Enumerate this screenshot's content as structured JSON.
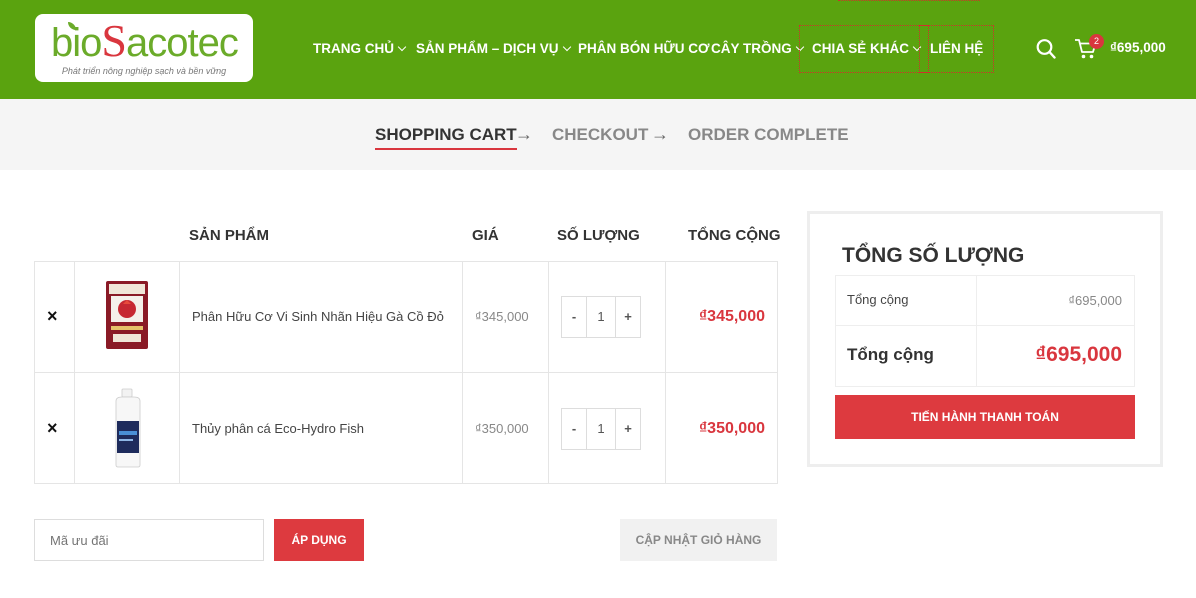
{
  "logo": {
    "text_a": "bio",
    "text_b": "S",
    "text_c": "acotec",
    "tagline": "Phát triển nông nghiệp sạch và bền vững"
  },
  "nav": [
    {
      "label": "TRANG CHỦ",
      "dropdown": true
    },
    {
      "label": "SẢN PHẨM – DỊCH VỤ",
      "dropdown": true
    },
    {
      "label": "PHÂN BÓN HỮU CƠ",
      "dropdown": false
    },
    {
      "label": "CÂY TRỒNG",
      "dropdown": true
    },
    {
      "label": "CHIA SẺ KHÁC",
      "dropdown": true
    },
    {
      "label": "LIÊN HỆ",
      "dropdown": false
    }
  ],
  "header": {
    "cart_count": "2",
    "cart_total": "₫695,000",
    "search_icon": "search-icon",
    "cart_icon": "cart-icon"
  },
  "steps": {
    "s1": "SHOPPING CART",
    "s2": "CHECKOUT",
    "s3": "ORDER COMPLETE",
    "arrow": "→"
  },
  "table": {
    "headers": {
      "product": "SẢN PHẨM",
      "price": "GIÁ",
      "qty": "SỐ LƯỢNG",
      "total": "TỔNG CỘNG"
    },
    "rows": [
      {
        "remove": "×",
        "name": "Phân Hữu Cơ Vi Sinh Nhãn Hiệu Gà Cồ Đỏ",
        "price": "₫345,000",
        "minus": "-",
        "qty": "1",
        "plus": "+",
        "subtotal": "₫345,000"
      },
      {
        "remove": "×",
        "name": "Thủy phân cá Eco-Hydro Fish",
        "price": "₫350,000",
        "minus": "-",
        "qty": "1",
        "plus": "+",
        "subtotal": "₫350,000"
      }
    ]
  },
  "coupon": {
    "placeholder": "Mã ưu đãi",
    "apply": "ÁP DỤNG",
    "update": "CẬP NHẬT GIỎ HÀNG"
  },
  "totals": {
    "title": "TỔNG SỐ LƯỢNG",
    "subtotal_label": "Tổng cộng",
    "subtotal_value": "₫695,000",
    "total_label": "Tổng cộng",
    "total_value": "₫695,000",
    "checkout": "TIẾN HÀNH THANH TOÁN"
  },
  "colors": {
    "header_green": "#5aa30f",
    "accent_red": "#dd3a3f"
  }
}
